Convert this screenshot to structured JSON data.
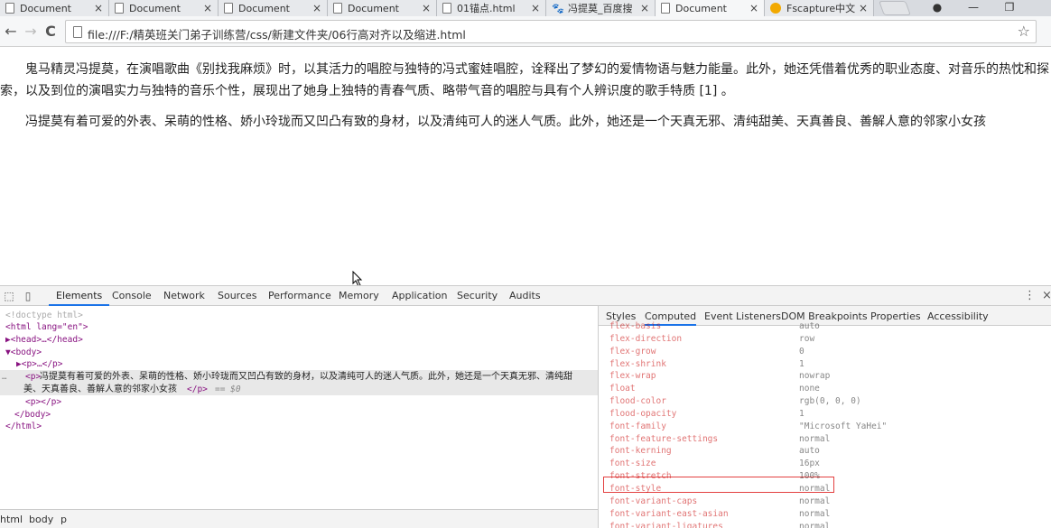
{
  "tabs": [
    {
      "label": "Document",
      "icon": "page-icon"
    },
    {
      "label": "Document",
      "icon": "page-icon"
    },
    {
      "label": "Document",
      "icon": "page-icon"
    },
    {
      "label": "Document",
      "icon": "page-icon"
    },
    {
      "label": "01锚点.html",
      "icon": "page-icon"
    },
    {
      "label": "冯提莫_百度搜",
      "icon": "baidu-icon"
    },
    {
      "label": "Document",
      "icon": "page-icon",
      "active": true
    },
    {
      "label": "Fscapture中文",
      "icon": "fscapture-icon"
    }
  ],
  "tab_close_glyph": "×",
  "window_controls": {
    "user": "●",
    "minimize": "—",
    "restore": "❐"
  },
  "address_bar": {
    "url": "file:///F:/精英班关门弟子训练营/css/新建文件夹/06行高对齐以及缩进.html",
    "back": "←",
    "forward": "→",
    "reload": "C",
    "star": "☆"
  },
  "page": {
    "paragraphs": [
      "鬼马精灵冯提莫，在演唱歌曲《别找我麻烦》时，以其活力的唱腔与独特的冯式蜜娃唱腔，诠释出了梦幻的爱情物语与魅力能量。此外，她还凭借着优秀的职业态度、对音乐的热忱和探索，以及到位的演唱实力与独特的音乐个性，展现出了她身上独特的青春气质、略带气音的唱腔与具有个人辨识度的歌手特质 [1] 。",
      "冯提莫有着可爱的外表、呆萌的性格、娇小玲珑而又凹凸有致的身材，以及清纯可人的迷人气质。此外，她还是一个天真无邪、清纯甜美、天真善良、善解人意的邻家小女孩"
    ]
  },
  "devtools": {
    "tabs": [
      "Elements",
      "Console",
      "Network",
      "Sources",
      "Performance",
      "Memory",
      "Application",
      "Security",
      "Audits"
    ],
    "active_tab": "Elements",
    "menu_glyph": "⋮",
    "close_glyph": "×",
    "elements_tree": [
      {
        "kind": "comment",
        "text": "<!doctype html>"
      },
      {
        "kind": "open",
        "text": "<html lang=\"en\">"
      },
      {
        "kind": "collapsed",
        "text": "▶<head>…</head>"
      },
      {
        "kind": "open",
        "text": "▼<body>"
      },
      {
        "kind": "collapsed",
        "text": "▶<p>…</p>"
      },
      {
        "kind": "selected_open",
        "text": "<p>"
      },
      {
        "kind": "text",
        "text": "冯提莫有着可爱的外表、呆萌的性格、娇小玲珑而又凹凸有致的身材，以及清纯可人的迷人气质。此外，她还是一个天真无邪、清纯甜"
      },
      {
        "kind": "text2",
        "text": "美、天真善良、善解人意的邻家小女孩"
      },
      {
        "kind": "close",
        "text": "</p>"
      },
      {
        "kind": "suffix",
        "text": "== $0"
      },
      {
        "kind": "open",
        "text": "<p></p>"
      },
      {
        "kind": "close",
        "text": "</body>"
      },
      {
        "kind": "close",
        "text": "</html>"
      }
    ],
    "breadcrumb": [
      "html",
      "body",
      "p"
    ],
    "side_tabs": [
      "Styles",
      "Computed",
      "Event Listeners",
      "DOM Breakpoints",
      "Properties",
      "Accessibility"
    ],
    "side_active": "Computed",
    "computed": [
      {
        "name": "flex-basis",
        "value": "auto"
      },
      {
        "name": "flex-direction",
        "value": "row"
      },
      {
        "name": "flex-grow",
        "value": "0"
      },
      {
        "name": "flex-shrink",
        "value": "1"
      },
      {
        "name": "flex-wrap",
        "value": "nowrap"
      },
      {
        "name": "float",
        "value": "none"
      },
      {
        "name": "flood-color",
        "value": "rgb(0, 0, 0)"
      },
      {
        "name": "flood-opacity",
        "value": "1"
      },
      {
        "name": "font-family",
        "value": "\"Microsoft YaHei\""
      },
      {
        "name": "font-feature-settings",
        "value": "normal"
      },
      {
        "name": "font-kerning",
        "value": "auto"
      },
      {
        "name": "font-size",
        "value": "16px",
        "highlighted": true
      },
      {
        "name": "font-stretch",
        "value": "100%"
      },
      {
        "name": "font-style",
        "value": "normal"
      },
      {
        "name": "font-variant-caps",
        "value": "normal"
      },
      {
        "name": "font-variant-east-asian",
        "value": "normal"
      },
      {
        "name": "font-variant-ligatures",
        "value": "normal"
      }
    ]
  }
}
